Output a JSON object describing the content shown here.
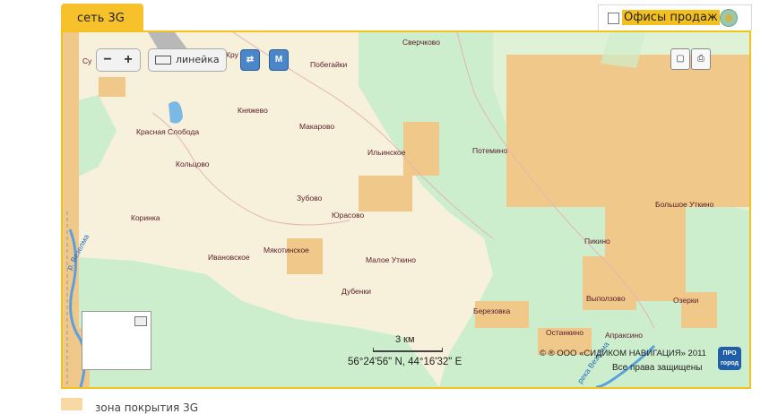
{
  "tab": {
    "label": "сеть 3G"
  },
  "offices": {
    "label": "Офисы продаж",
    "checked": false
  },
  "controls": {
    "zoom_out": "−",
    "zoom_in": "+",
    "ruler_label": "линейка",
    "traffic_label": "⇄",
    "metro_label": "М"
  },
  "places": [
    "Сверчково",
    "Побегайки",
    "Кру",
    "Су",
    "Княжево",
    "Макарово",
    "Красная Слобода",
    "Ильинское",
    "Потемино",
    "Кольцово",
    "Зубово",
    "Коринка",
    "Юрасово",
    "Большое Уткино",
    "Пикино",
    "Мякотинское",
    "Ивановское",
    "Малое Уткино",
    "Дубенки",
    "Выползово",
    "Озерки",
    "Березовка",
    "Останкино",
    "Апраксино"
  ],
  "rivers": [
    "р. Везелма",
    "река Везелма"
  ],
  "scale": {
    "label": "3 км"
  },
  "coords": "56°24'56\" N, 44°16'32\" E",
  "copyright": "© ® ООО «СИДИКОМ НАВИГАЦИЯ» 2011",
  "rights": "Все права защищены",
  "logo": "ПРО город",
  "legend": {
    "label": "зона покрытия 3G"
  },
  "colors": {
    "accent": "#f3c21f",
    "coverage": "#f0c98a",
    "forest": "#cdeecc",
    "field": "#f7f1db"
  }
}
